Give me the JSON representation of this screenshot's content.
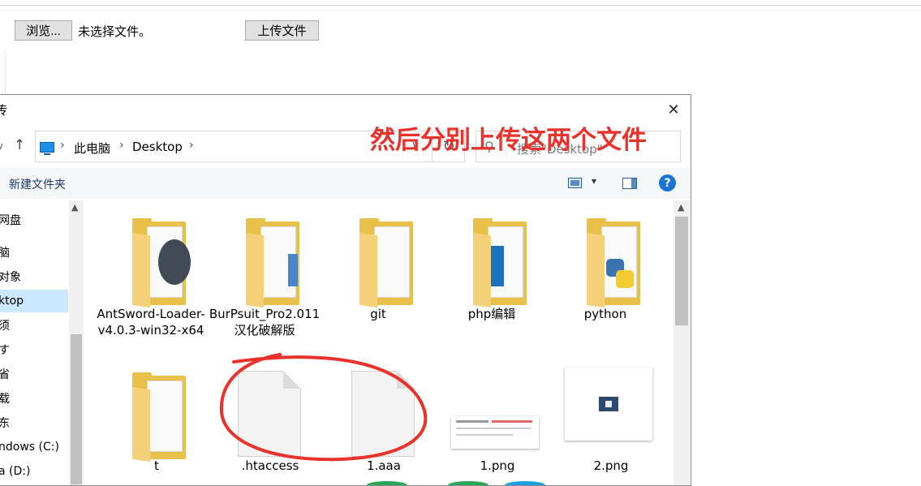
{
  "page": {
    "browse_button": "浏览...",
    "no_file_text": "未选择文件。",
    "upload_button": "上传文件"
  },
  "dialog": {
    "title_fragment": "传",
    "close_glyph": "✕",
    "address": {
      "location": "此电脑",
      "folder": "Desktop"
    },
    "search_placeholder": "搜索\"Desktop\"",
    "annotation": "然后分别上传这两个文件",
    "toolbar": {
      "new_folder": "新建文件夹",
      "help": "?"
    },
    "nav_items": [
      {
        "label": "网盘"
      },
      {
        "label": "脑"
      },
      {
        "label": "对象"
      },
      {
        "label": "ktop"
      },
      {
        "label": "须"
      },
      {
        "label": "す"
      },
      {
        "label": "省"
      },
      {
        "label": "载"
      },
      {
        "label": "东"
      },
      {
        "label": "ndows (C:)"
      },
      {
        "label": "a (D:)"
      }
    ],
    "files": [
      {
        "name": "AntSword-Loader-v4.0.3-win32-x64",
        "type": "folder",
        "icon": "folder-icon"
      },
      {
        "name": "BurPsuit_Pro2.011汉化破解版",
        "type": "folder",
        "icon": "folder-icon"
      },
      {
        "name": "git",
        "type": "folder",
        "icon": "folder-icon"
      },
      {
        "name": "php编辑",
        "type": "folder",
        "icon": "folder-icon"
      },
      {
        "name": "python",
        "type": "folder",
        "icon": "folder-icon"
      },
      {
        "name": "t",
        "type": "folder",
        "icon": "folder-icon"
      },
      {
        "name": ".htaccess",
        "type": "file",
        "icon": "document-icon"
      },
      {
        "name": "1.aaa",
        "type": "file",
        "icon": "document-icon"
      },
      {
        "name": "1.png",
        "type": "image",
        "icon": "image-thumbnail"
      },
      {
        "name": "2.png",
        "type": "image",
        "icon": "image-thumbnail"
      }
    ]
  },
  "colors": {
    "annotation_red": "#e8322b",
    "folder_yellow": "#e9c04a",
    "selection_blue": "#cce8ff",
    "help_blue": "#1a75d2"
  }
}
